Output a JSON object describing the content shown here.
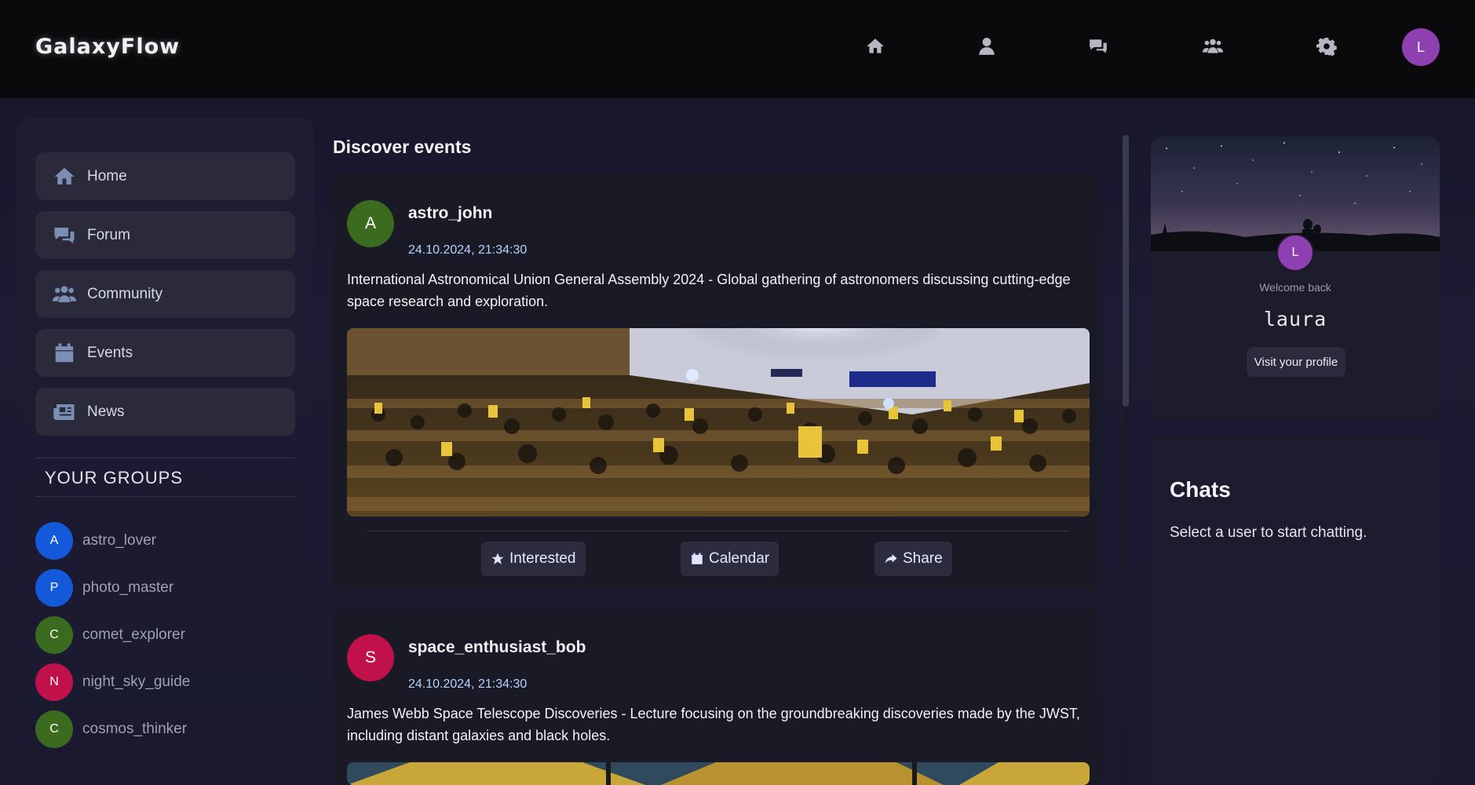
{
  "app": {
    "logo": "GalaxyFlow"
  },
  "topnav": {
    "icons": [
      "home-icon",
      "user-icon",
      "comments-icon",
      "users-icon",
      "gear-icon"
    ],
    "avatar_initial": "L"
  },
  "sidebar": {
    "items": [
      {
        "label": "Home",
        "icon": "home-icon"
      },
      {
        "label": "Forum",
        "icon": "comments-icon"
      },
      {
        "label": "Community",
        "icon": "users-icon"
      },
      {
        "label": "Events",
        "icon": "calendar-icon"
      },
      {
        "label": "News",
        "icon": "newspaper-icon"
      }
    ],
    "groups_title": "YOUR GROUPS",
    "groups": [
      {
        "initial": "A",
        "name": "astro_lover",
        "color": "#1459d9"
      },
      {
        "initial": "P",
        "name": "photo_master",
        "color": "#1459d9"
      },
      {
        "initial": "C",
        "name": "comet_explorer",
        "color": "#3b6b1e"
      },
      {
        "initial": "N",
        "name": "night_sky_guide",
        "color": "#c1114a"
      },
      {
        "initial": "C",
        "name": "cosmos_thinker",
        "color": "#3b6b1e"
      }
    ]
  },
  "feed": {
    "title": "Discover events",
    "events": [
      {
        "initial": "A",
        "avatar_color": "#3b6b1e",
        "user": "astro_john",
        "date": "24.10.2024, 21:34:30",
        "description": "International Astronomical Union General Assembly 2024 - Global gathering of astronomers discussing cutting-edge space research and exploration.",
        "image": "assembly-hall-photo"
      },
      {
        "initial": "S",
        "avatar_color": "#c1114a",
        "user": "space_enthusiast_bob",
        "date": "24.10.2024, 21:34:30",
        "description": "James Webb Space Telescope Discoveries - Lecture focusing on the groundbreaking discoveries made by the JWST, including distant galaxies and black holes.",
        "image": "telescope-photo"
      }
    ],
    "actions": {
      "interested": "Interested",
      "calendar": "Calendar",
      "share": "Share"
    }
  },
  "profile": {
    "avatar_initial": "L",
    "welcome": "Welcome back",
    "username": "laura",
    "visit_label": "Visit your profile"
  },
  "chats": {
    "title": "Chats",
    "hint": "Select a user to start chatting."
  },
  "colors": {
    "accent_purple": "#8e3fb0",
    "date_blue": "#b4d3ff"
  }
}
